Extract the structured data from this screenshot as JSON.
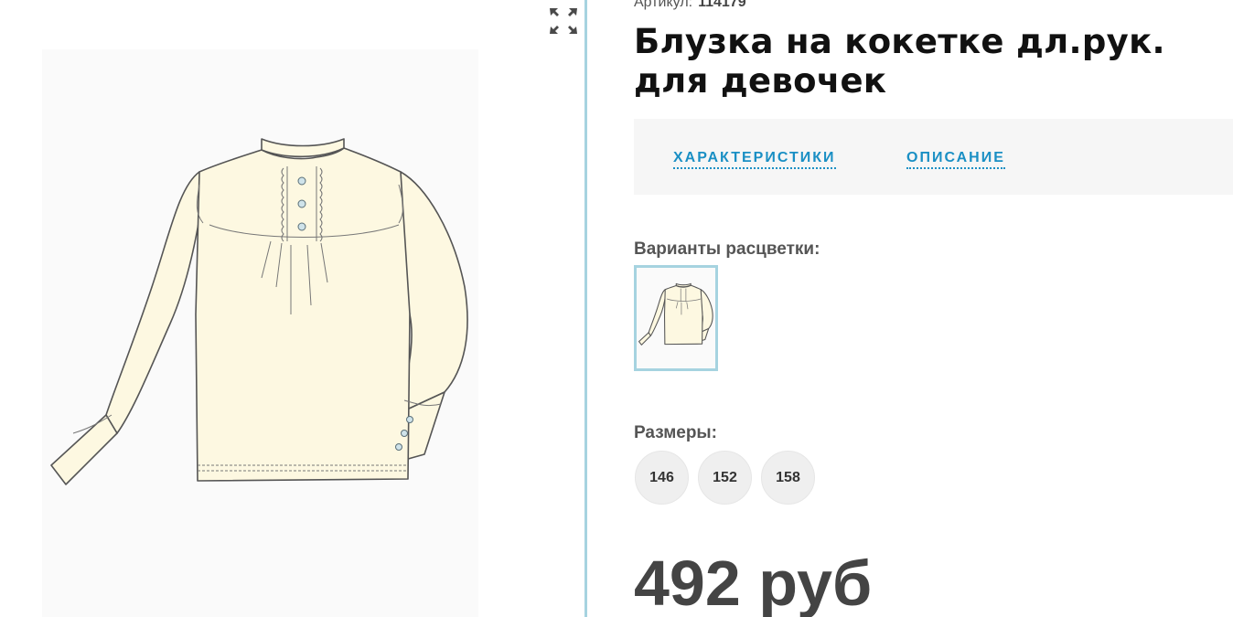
{
  "product": {
    "article_label": "Артикул:",
    "article_number": "114179",
    "title": "Блузка на кокетке дл.рук. для девочек",
    "price": "492 руб"
  },
  "tabs": [
    {
      "label": "ХАРАКТЕРИСТИКИ"
    },
    {
      "label": "ОПИСАНИЕ"
    }
  ],
  "colors": {
    "label": "Варианты расцветки:"
  },
  "sizes": {
    "label": "Размеры:",
    "options": [
      "146",
      "152",
      "158"
    ]
  },
  "icons": {
    "expand": "expand-icon"
  },
  "theme": {
    "accent": "#1a8fc4",
    "divider": "#a6d3e0",
    "garment": "#fdf8e1"
  }
}
